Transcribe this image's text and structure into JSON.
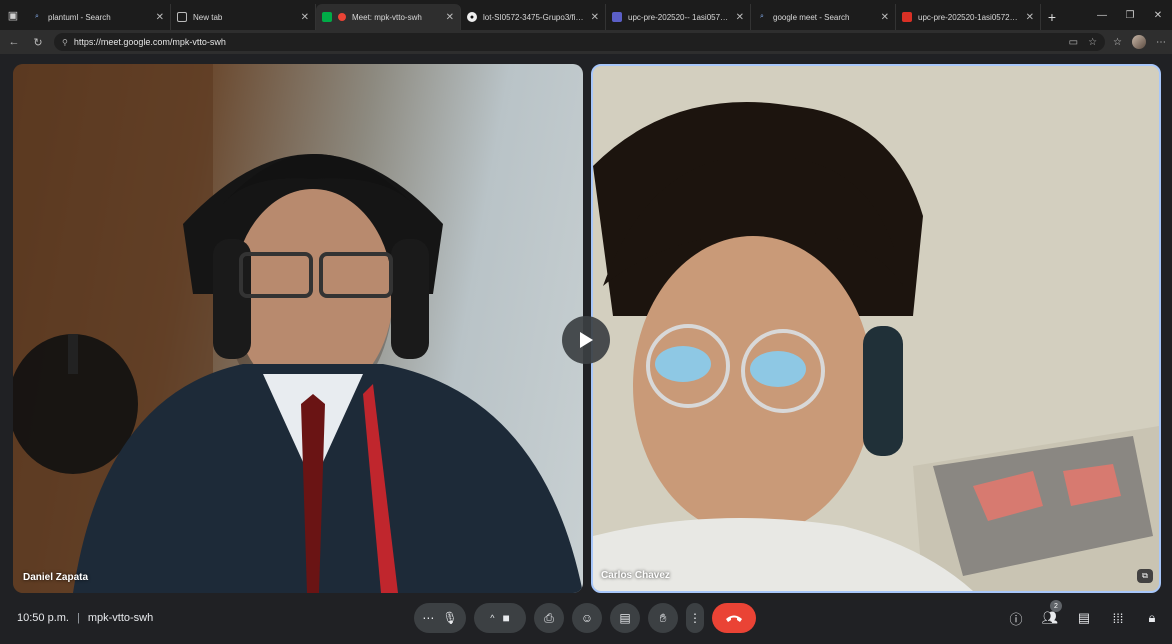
{
  "browser": {
    "tabs": [
      {
        "title": "plantuml - Search",
        "favicon": "search-icon",
        "active": false
      },
      {
        "title": "New tab",
        "favicon": "newtab-icon",
        "active": false
      },
      {
        "title": "Meet: mpk-vtto-swh",
        "favicon": "meet-icon",
        "active": true
      },
      {
        "title": "lot-SI0572-3475-Grupo3/final-p",
        "favicon": "github-icon",
        "active": false
      },
      {
        "title": "upc-pre-202520-- 1asi0572-7281",
        "favicon": "chat-icon",
        "active": false
      },
      {
        "title": "google meet - Search",
        "favicon": "search-icon",
        "active": false
      },
      {
        "title": "upc-pre-202520-1asi0572-final_c",
        "favicon": "pdf-icon",
        "active": false
      }
    ],
    "url": "https://meet.google.com/mpk-vtto-swh"
  },
  "meeting": {
    "time": "10:50 p.m.",
    "separator": "|",
    "code": "mpk-vtto-swh",
    "participants_count": "2"
  },
  "participants": [
    {
      "name": "Daniel Zapata"
    },
    {
      "name": "Carlos Chavez"
    }
  ],
  "colors": {
    "end_call": "#ea4335",
    "active_speaker_border": "#a8c7fa",
    "control_bg": "#3c4043"
  }
}
